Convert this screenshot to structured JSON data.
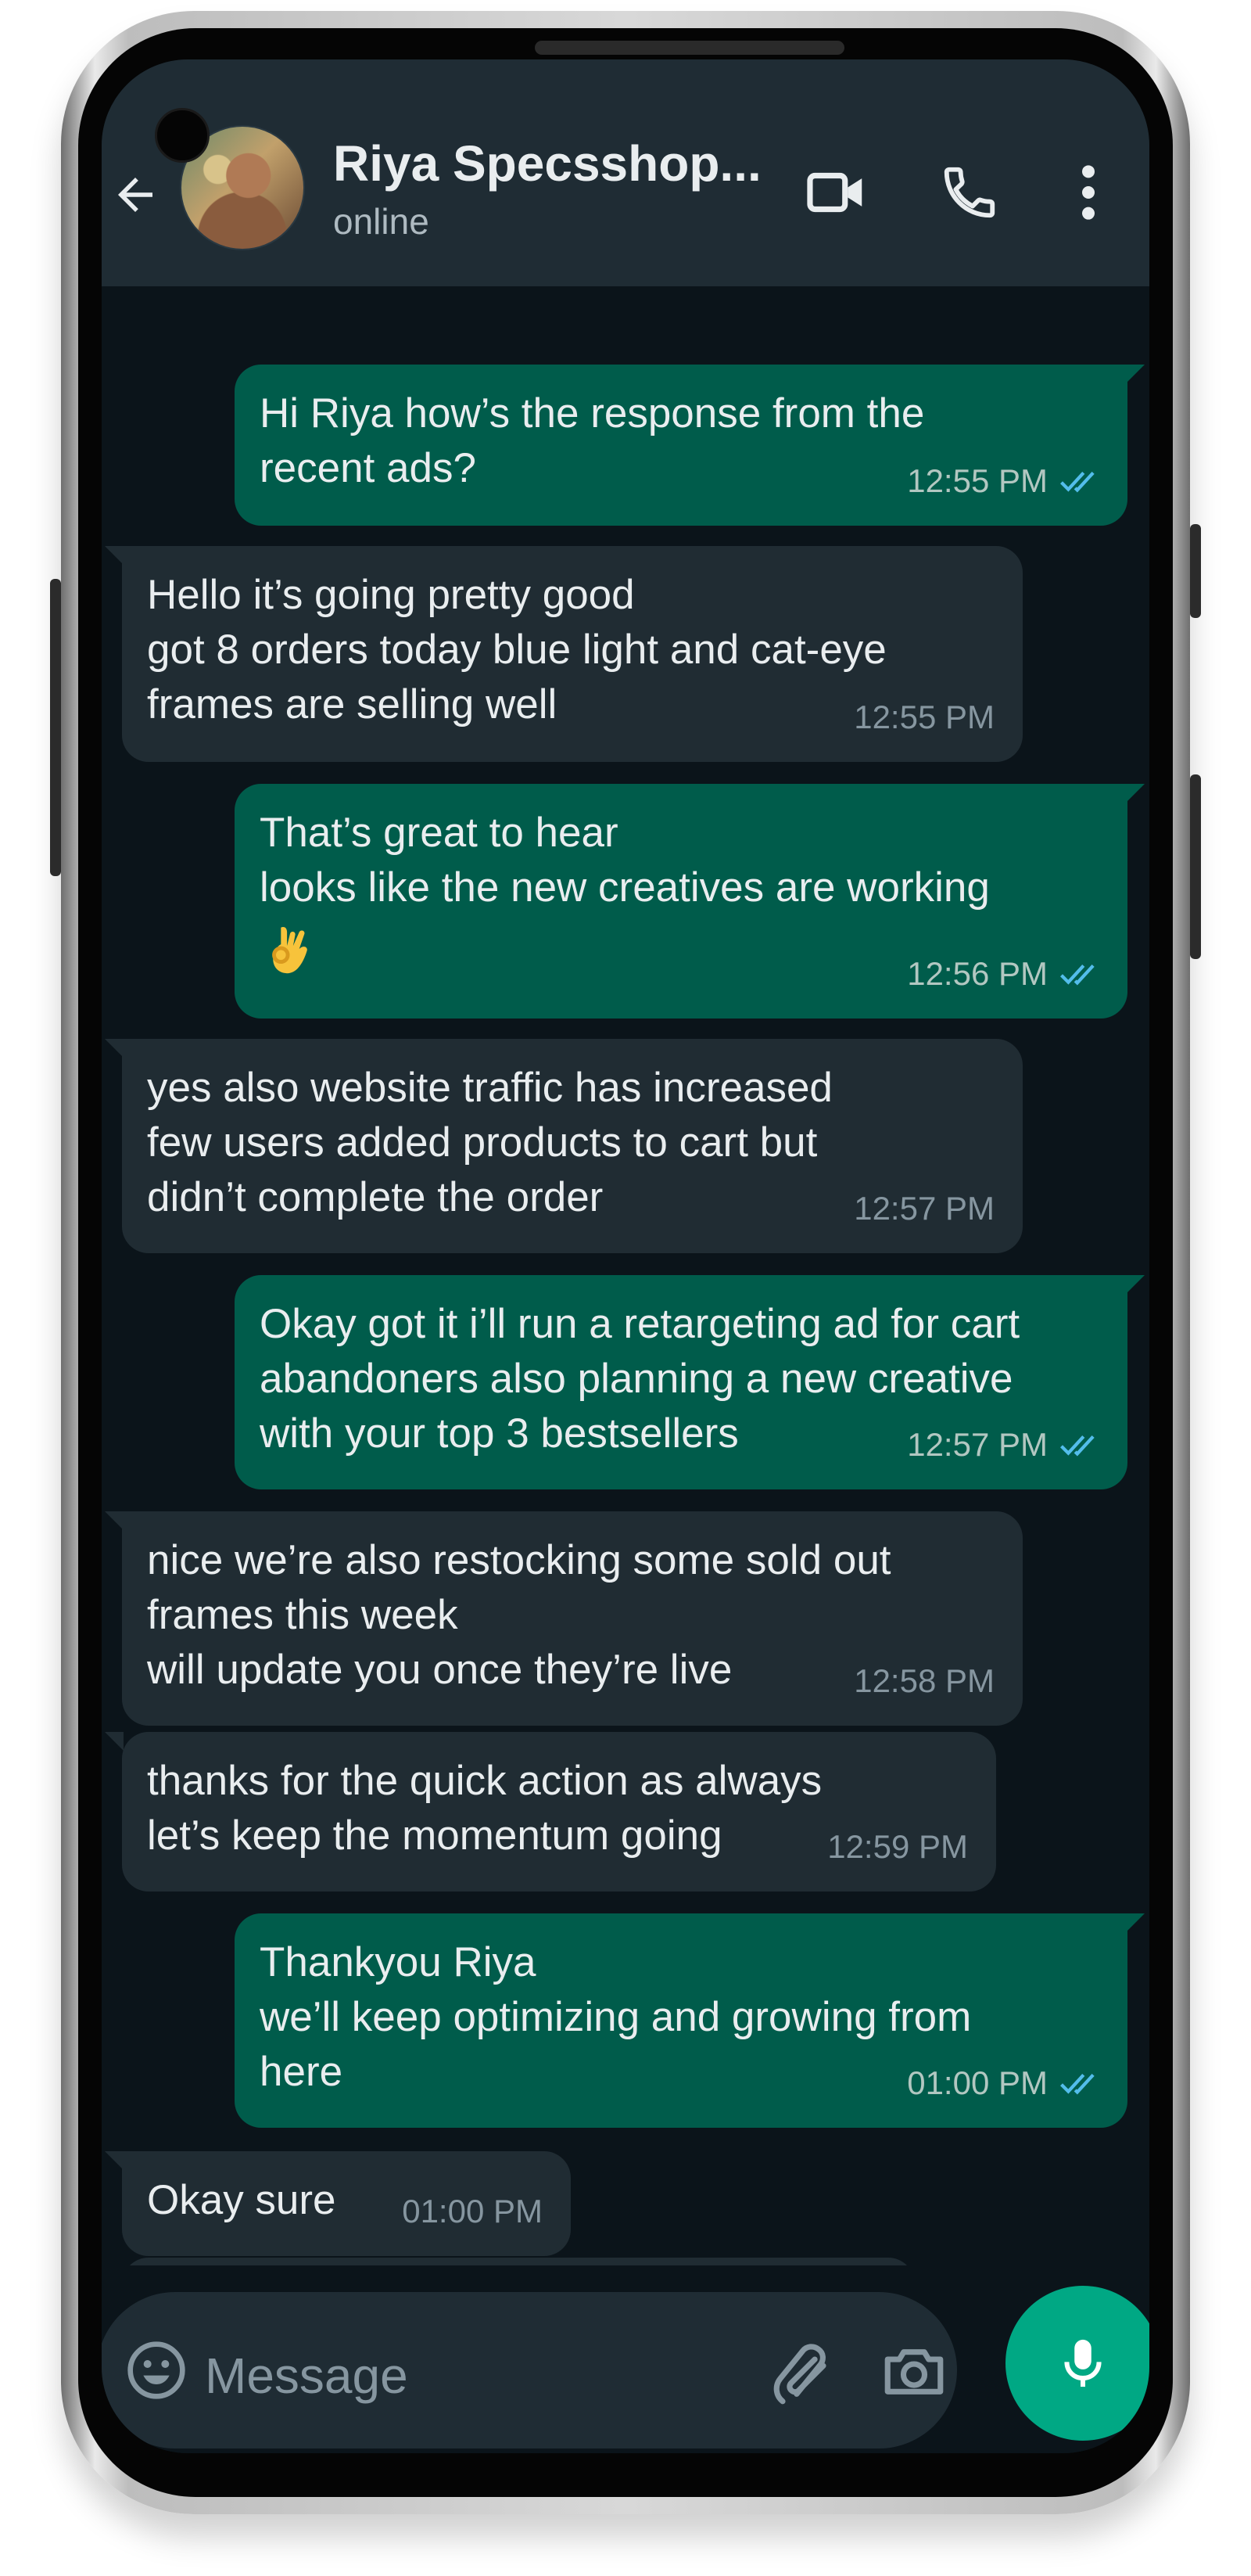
{
  "header": {
    "contact_name": "Riya Specsshop...",
    "status": "online"
  },
  "messages": [
    {
      "direction": "out",
      "text": "Hi Riya how’s the response from the\nrecent ads?",
      "time": "12:55 PM",
      "read": true
    },
    {
      "direction": "in",
      "text": "Hello it’s going pretty good\ngot 8 orders today blue light and cat-eye\nframes are selling well",
      "time": "12:55 PM"
    },
    {
      "direction": "out",
      "text": "That’s great to hear\nlooks like the new creatives are working",
      "emoji": "ok-hand-emoji",
      "time": "12:56 PM",
      "read": true
    },
    {
      "direction": "in",
      "text": "yes also website traffic has increased\nfew users added products to cart but\ndidn’t complete the order",
      "time": "12:57 PM"
    },
    {
      "direction": "out",
      "text": "Okay got it i’ll run a retargeting ad for cart\nabandoners also planning a new creative\nwith your top 3 bestsellers",
      "time": "12:57 PM",
      "read": true
    },
    {
      "direction": "in",
      "text": "nice we’re also restocking some sold out\nframes this week\nwill update you once they’re live",
      "time": "12:58 PM"
    },
    {
      "direction": "in",
      "text": "thanks for the quick action as always\nlet’s keep the momentum going",
      "time": "12:59 PM"
    },
    {
      "direction": "out",
      "text": "Thankyou Riya\nwe’ll keep optimizing and growing from\nhere",
      "time": "01:00 PM",
      "read": true
    },
    {
      "direction": "in",
      "text": "Okay sure",
      "time": "01:00 PM"
    }
  ],
  "input": {
    "placeholder": "Message"
  },
  "colors": {
    "header_bg": "#1f2c34",
    "chat_bg": "#0b141a",
    "outgoing_bubble": "#005c4b",
    "incoming_bubble": "#202c33",
    "read_ticks": "#53bdeb",
    "accent": "#00a884"
  },
  "icons": {
    "back": "arrow-left-icon",
    "video": "video-call-icon",
    "call": "phone-icon",
    "menu": "more-vertical-icon",
    "emoji": "emoji-icon",
    "attach": "paperclip-icon",
    "camera": "camera-icon",
    "mic": "mic-icon"
  }
}
